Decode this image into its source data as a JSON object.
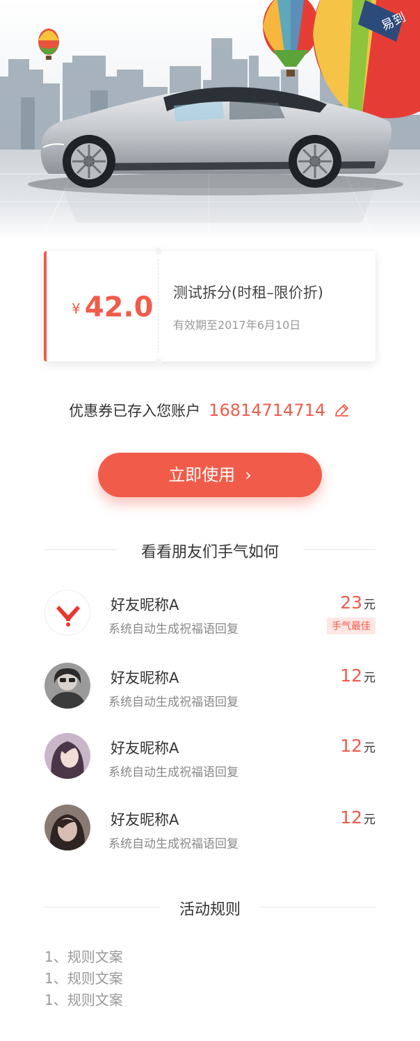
{
  "hero": {
    "brand_tag": "易到"
  },
  "coupon": {
    "currency": "¥",
    "amount": "42.0",
    "title": "测试拆分(时租–限价折)",
    "valid": "有效期至2017年6月10日",
    "accent_color": "#f15b4a"
  },
  "account": {
    "text": "优惠券已存入您账户",
    "phone": "16814714714",
    "edit_icon": "edit-icon"
  },
  "use_button": {
    "label": "立即使用",
    "chevron": "›"
  },
  "friends_section": {
    "title": "看看朋友们手气如何",
    "items": [
      {
        "name": "好友昵称A",
        "message": "系统自动生成祝福语回复",
        "amount": "23",
        "unit": "元",
        "badge": "手气最佳",
        "avatar": "yidao-logo-avatar"
      },
      {
        "name": "好友昵称A",
        "message": "系统自动生成祝福语回复",
        "amount": "12",
        "unit": "元",
        "badge": "",
        "avatar": "user-photo-avatar"
      },
      {
        "name": "好友昵称A",
        "message": "系统自动生成祝福语回复",
        "amount": "12",
        "unit": "元",
        "badge": "",
        "avatar": "user-photo-avatar"
      },
      {
        "name": "好友昵称A",
        "message": "系统自动生成祝福语回复",
        "amount": "12",
        "unit": "元",
        "badge": "",
        "avatar": "user-photo-avatar"
      }
    ]
  },
  "rules_section": {
    "title": "活动规则",
    "items": [
      "1、规则文案",
      "1、规则文案",
      "1、规则文案"
    ]
  }
}
